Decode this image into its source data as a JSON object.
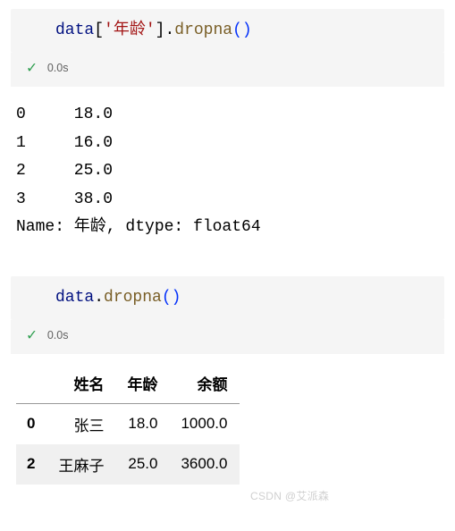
{
  "cell1": {
    "code": {
      "obj": "data",
      "open_bracket": "[",
      "string": "'年龄'",
      "close_bracket": "]",
      "dot": ".",
      "method": "dropna",
      "open_paren": "(",
      "close_paren": ")"
    },
    "status": {
      "check": "✓",
      "time": "0.0s"
    },
    "output": "0     18.0\n1     16.0\n2     25.0\n3     38.0\nName: 年龄, dtype: float64"
  },
  "cell2": {
    "code": {
      "obj": "data",
      "dot": ".",
      "method": "dropna",
      "open_paren": "(",
      "close_paren": ")"
    },
    "status": {
      "check": "✓",
      "time": "0.0s"
    },
    "table": {
      "columns": [
        "姓名",
        "年龄",
        "余额"
      ],
      "index": [
        "0",
        "2"
      ],
      "rows": [
        [
          "张三",
          "18.0",
          "1000.0"
        ],
        [
          "王麻子",
          "25.0",
          "3600.0"
        ]
      ]
    }
  },
  "watermark": "CSDN @艾派森"
}
